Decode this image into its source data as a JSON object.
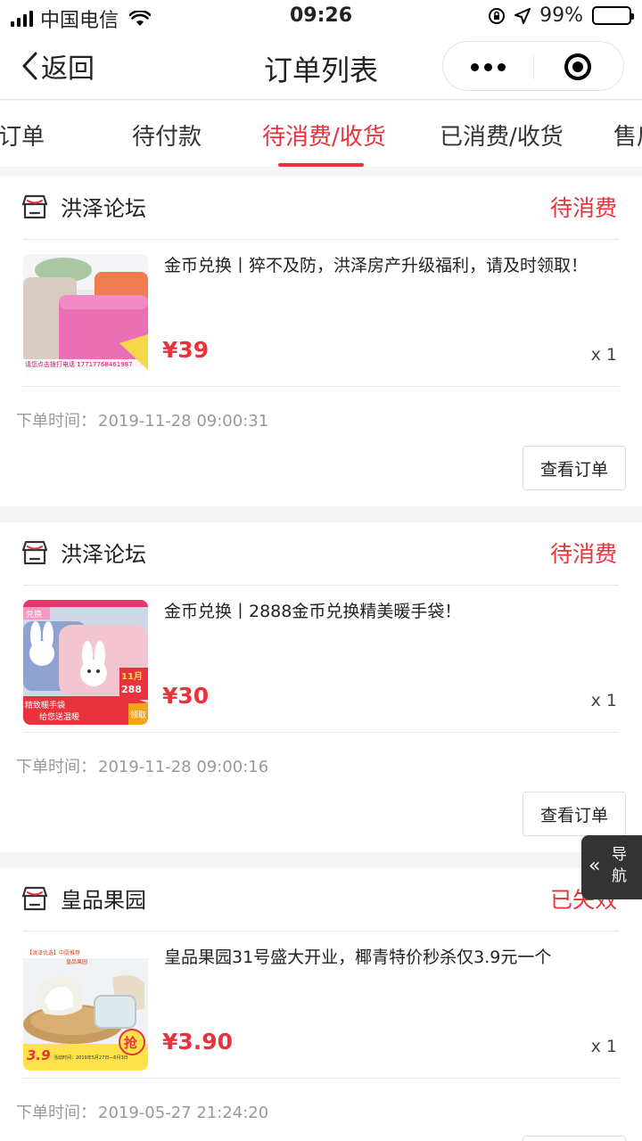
{
  "status_bar": {
    "carrier": "中国电信",
    "time": "09:26",
    "battery": "99%",
    "battery_level": 0.99,
    "icons": [
      "signal-icon",
      "wifi-icon",
      "rotation-lock-icon",
      "location-icon",
      "battery-icon"
    ]
  },
  "nav": {
    "back_label": "返回",
    "title": "订单列表",
    "icons": [
      "back-chevron-icon",
      "more-dots-icon",
      "close-target-icon"
    ]
  },
  "tabs": [
    {
      "label": "全部订单"
    },
    {
      "label": "待付款"
    },
    {
      "label": "待消费/收货",
      "active": true
    },
    {
      "label": "已消费/收货"
    },
    {
      "label": "售后"
    }
  ],
  "labels": {
    "order_time": "下单时间：",
    "view_order": "查看订单"
  },
  "orders": [
    {
      "store": "洪泽论坛",
      "status": "待消费",
      "title": "金币兑换丨猝不及防，洪泽房产升级福利，请及时领取！",
      "price": "¥39",
      "qty": "x 1",
      "order_time": "2019-11-28 09:00:31",
      "thumb_text": "请您点击拨打电话 17717768461987"
    },
    {
      "store": "洪泽论坛",
      "status": "待消费",
      "title": "金币兑换丨2888金币兑换精美暖手袋！",
      "price": "¥30",
      "qty": "x 1",
      "order_time": "2019-11-28 09:00:16",
      "thumb_text": [
        "兑换",
        "11月",
        "288",
        "精致暖手袋",
        "给您送温暖",
        "领取"
      ]
    },
    {
      "store": "皇品果园",
      "status": "已失效",
      "title": "皇品果园31号盛大开业，椰青特价秒杀仅3.9元一个",
      "price": "¥3.90",
      "qty": "x 1",
      "order_time": "2019-05-27 21:24:20",
      "thumb_text": [
        "【洪泽优选】中厨推荐",
        "皇品果园",
        "3.9",
        "抢",
        "活动时间：2019年5月27日—6月3日"
      ]
    }
  ],
  "guide": {
    "label": "导航"
  },
  "colors": {
    "accent": "#e8323c",
    "background": "#f4f4f4",
    "text": "#222222",
    "muted": "#999999"
  }
}
